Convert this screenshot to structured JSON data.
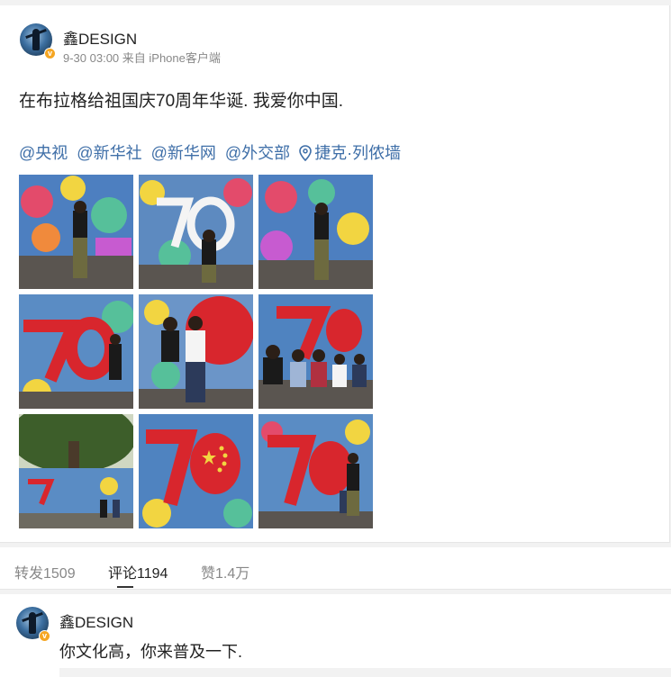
{
  "post": {
    "username": "鑫DESIGN",
    "meta": "9-30 03:00 来自 iPhone客户端",
    "text": "在布拉格给祖国庆70周年华诞. 我爱你中国.",
    "mentions": [
      "@央视",
      "@新华社",
      "@新华网",
      "@外交部"
    ],
    "location": "捷克·列侬墙",
    "verified_badge": "v",
    "photos": [
      {
        "label": "lennon-wall-photo-1"
      },
      {
        "label": "lennon-wall-photo-2"
      },
      {
        "label": "lennon-wall-photo-3"
      },
      {
        "label": "lennon-wall-photo-4"
      },
      {
        "label": "lennon-wall-photo-5"
      },
      {
        "label": "lennon-wall-photo-6"
      },
      {
        "label": "lennon-wall-photo-7"
      },
      {
        "label": "lennon-wall-photo-8"
      },
      {
        "label": "lennon-wall-photo-9"
      }
    ]
  },
  "stats": {
    "repost": "转发1509",
    "comment": "评论1194",
    "like": "赞1.4万",
    "active_tab": "comment"
  },
  "comment": {
    "username": "鑫DESIGN",
    "text": "你文化高，你来普及一下.",
    "verified_badge": "v"
  },
  "colors": {
    "link": "#3f6fa8",
    "badge": "#f5a623",
    "background": "#f2f2f2"
  }
}
